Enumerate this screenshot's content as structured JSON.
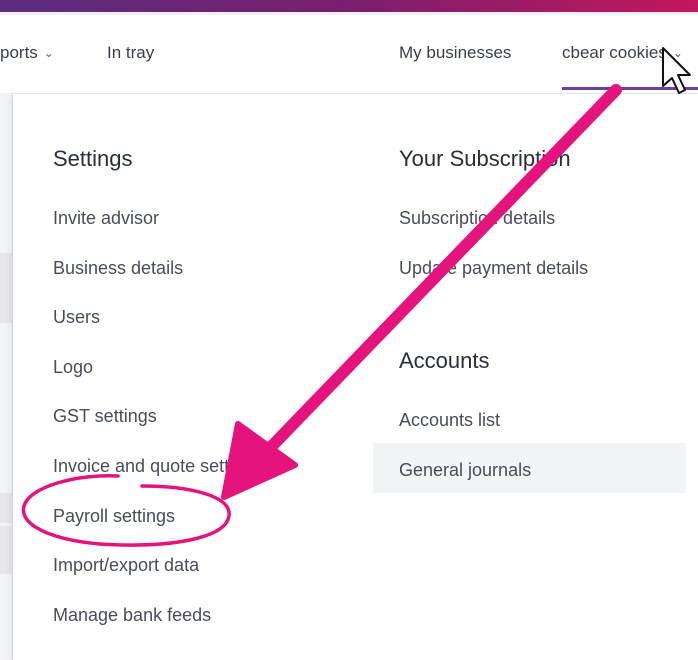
{
  "nav": {
    "reports_label": "ports",
    "intray_label": "In tray",
    "my_businesses_label": "My businesses",
    "account_label": "cbear cookies"
  },
  "menu": {
    "settings_heading": "Settings",
    "settings_items": [
      "Invite advisor",
      "Business details",
      "Users",
      "Logo",
      "GST settings",
      "Invoice and quote settings",
      "Payroll settings",
      "Import/export data",
      "Manage bank feeds"
    ],
    "subscription_heading": "Your Subscription",
    "subscription_items": [
      "Subscription details",
      "Update payment details"
    ],
    "accounts_heading": "Accounts",
    "accounts_items": [
      "Accounts list",
      "General journals"
    ]
  },
  "icons": {
    "chevron": "chevron-down-icon",
    "cursor": "mouse-cursor-icon",
    "annotation_arrow": "arrow-annotation-icon",
    "annotation_circle": "highlight-circle-icon"
  },
  "colors": {
    "accent_purple": "#6b3fa0",
    "annotation_pink": "#e5137c"
  }
}
